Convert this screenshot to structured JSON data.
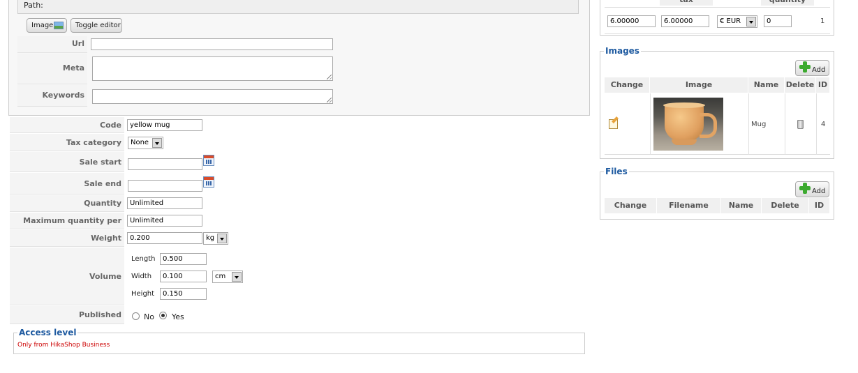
{
  "path": {
    "label": "Path:"
  },
  "editor_buttons": {
    "image": "Image",
    "toggle": "Toggle editor"
  },
  "seo": {
    "url": {
      "label": "Url",
      "value": ""
    },
    "meta_description": {
      "label": "Meta description",
      "value": ""
    },
    "keywords": {
      "label": "Keywords",
      "value": ""
    }
  },
  "form": {
    "code": {
      "label": "Code",
      "value": "yellow mug"
    },
    "tax_category": {
      "label": "Tax category",
      "value": "None"
    },
    "sale_start": {
      "label": "Sale start",
      "value": ""
    },
    "sale_end": {
      "label": "Sale end",
      "value": ""
    },
    "quantity": {
      "label": "Quantity",
      "value": "Unlimited"
    },
    "max_quantity": {
      "label": "Maximum quantity per order",
      "value": "Unlimited"
    },
    "weight": {
      "label": "Weight",
      "value": "0.200",
      "unit": "kg"
    },
    "volume": {
      "label": "Volume",
      "length": {
        "label": "Length",
        "value": "0.500"
      },
      "width": {
        "label": "Width",
        "value": "0.100"
      },
      "height": {
        "label": "Height",
        "value": "0.150"
      },
      "unit": "cm"
    },
    "published": {
      "label": "Published",
      "no": "No",
      "yes": "Yes",
      "selected": "Yes"
    }
  },
  "access_level": {
    "legend": "Access level",
    "text": "Only from HikaShop Business"
  },
  "price_table": {
    "headers": [
      "tax",
      "quantity"
    ],
    "row": {
      "price": "6.00000",
      "price_tax": "6.00000",
      "currency": "€ EUR",
      "min_quantity": "0",
      "id": "1"
    }
  },
  "images": {
    "legend": "Images",
    "add_label": "Add",
    "columns": [
      "Change",
      "Image",
      "Name",
      "Delete",
      "ID"
    ],
    "rows": [
      {
        "name": "Mug",
        "id": "4"
      }
    ]
  },
  "files": {
    "legend": "Files",
    "add_label": "Add",
    "columns": [
      "Change",
      "Filename",
      "Name",
      "Delete",
      "ID"
    ]
  },
  "colors": {
    "legend": "#1e5aa0",
    "access_text": "#cc0000",
    "add_green": "#3caa2f"
  }
}
